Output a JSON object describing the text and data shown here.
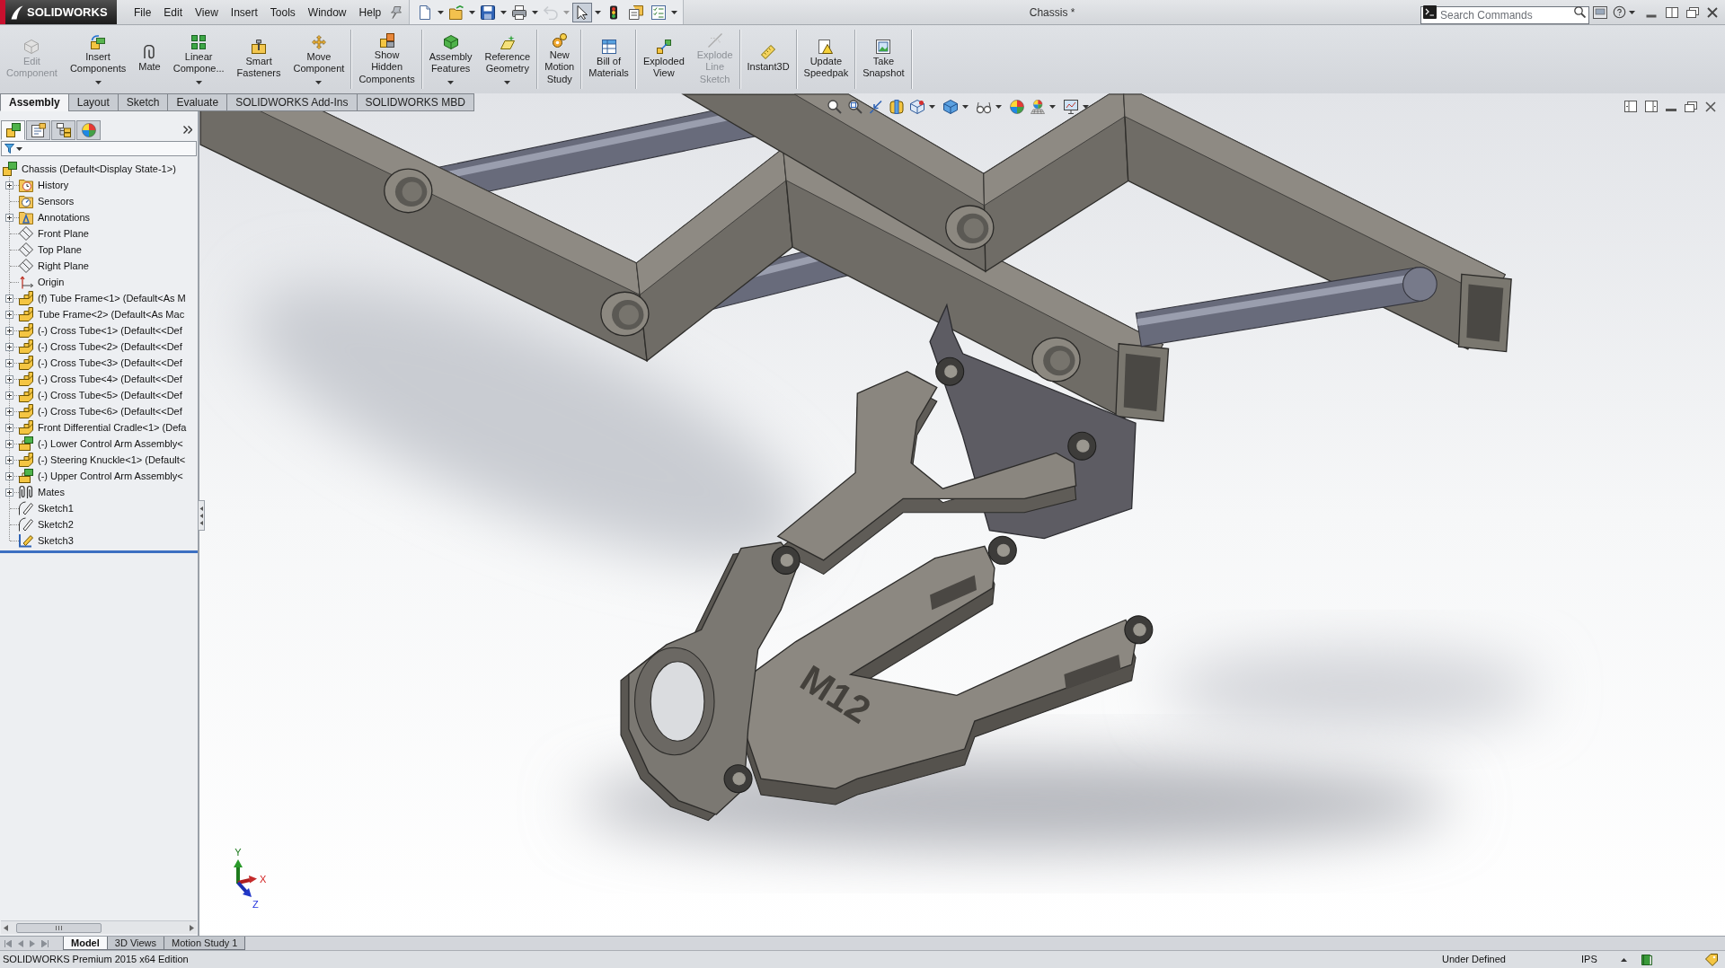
{
  "app": {
    "logo": "SOLIDWORKS",
    "title": "Chassis *"
  },
  "menu_bar": [
    "File",
    "Edit",
    "View",
    "Insert",
    "Tools",
    "Window",
    "Help"
  ],
  "quick_access": [
    {
      "menu": true,
      "disabled": false,
      "selected": false
    },
    {
      "menu": true,
      "disabled": false,
      "selected": false
    },
    {
      "menu": true,
      "disabled": false,
      "selected": false
    },
    {
      "menu": true,
      "disabled": false,
      "selected": false
    },
    {
      "menu": true,
      "disabled": true,
      "selected": false
    },
    {
      "menu": true,
      "disabled": false,
      "selected": true
    },
    {
      "menu": false,
      "disabled": false,
      "selected": false
    },
    {
      "menu": false,
      "disabled": false,
      "selected": false
    },
    {
      "menu": true,
      "disabled": false,
      "selected": false
    }
  ],
  "search": {
    "placeholder": "Search Commands"
  },
  "command_groups": [
    [
      {
        "label": [
          "Edit",
          "Component"
        ],
        "disabled": true,
        "menu": false
      },
      {
        "label": [
          "Insert",
          "Components"
        ],
        "disabled": false,
        "menu": true
      },
      {
        "label": [
          "Mate"
        ],
        "disabled": false,
        "menu": false
      },
      {
        "label": [
          "Linear",
          "Compone..."
        ],
        "disabled": false,
        "menu": true
      },
      {
        "label": [
          "Smart",
          "Fasteners"
        ],
        "disabled": false,
        "menu": false
      },
      {
        "label": [
          "Move",
          "Component"
        ],
        "disabled": false,
        "menu": true
      }
    ],
    [
      {
        "label": [
          "Show",
          "Hidden",
          "Components"
        ],
        "disabled": false,
        "menu": false
      }
    ],
    [
      {
        "label": [
          "Assembly",
          "Features"
        ],
        "disabled": false,
        "menu": true
      },
      {
        "label": [
          "Reference",
          "Geometry"
        ],
        "disabled": false,
        "menu": true
      }
    ],
    [
      {
        "label": [
          "New",
          "Motion",
          "Study"
        ],
        "disabled": false,
        "menu": false
      }
    ],
    [
      {
        "label": [
          "Bill of",
          "Materials"
        ],
        "disabled": false,
        "menu": false
      }
    ],
    [
      {
        "label": [
          "Exploded",
          "View"
        ],
        "disabled": false,
        "menu": false
      },
      {
        "label": [
          "Explode",
          "Line",
          "Sketch"
        ],
        "disabled": true,
        "menu": false
      }
    ],
    [
      {
        "label": [
          "Instant3D"
        ],
        "disabled": false,
        "menu": false
      }
    ],
    [
      {
        "label": [
          "Update",
          "Speedpak"
        ],
        "disabled": false,
        "menu": false
      }
    ],
    [
      {
        "label": [
          "Take",
          "Snapshot"
        ],
        "disabled": false,
        "menu": false
      }
    ]
  ],
  "command_tabs": [
    {
      "label": "Assembly",
      "selected": true
    },
    {
      "label": "Layout",
      "selected": false
    },
    {
      "label": "Sketch",
      "selected": false
    },
    {
      "label": "Evaluate",
      "selected": false
    },
    {
      "label": "SOLIDWORKS Add-Ins",
      "selected": false
    },
    {
      "label": "SOLIDWORKS MBD",
      "selected": false
    }
  ],
  "panel_tabs": [
    {
      "selected": true
    },
    {
      "selected": false
    },
    {
      "selected": false
    },
    {
      "selected": false
    }
  ],
  "feature_tree": {
    "label": "Chassis (Default<Display State-1>)",
    "kind": "assembly",
    "children": [
      {
        "label": "History",
        "kind": "history",
        "expandable": true
      },
      {
        "label": "Sensors",
        "kind": "sensors",
        "expandable": false
      },
      {
        "label": "Annotations",
        "kind": "annotations",
        "expandable": true
      },
      {
        "label": "Front Plane",
        "kind": "plane",
        "expandable": false
      },
      {
        "label": "Top Plane",
        "kind": "plane",
        "expandable": false
      },
      {
        "label": "Right Plane",
        "kind": "plane",
        "expandable": false
      },
      {
        "label": "Origin",
        "kind": "origin",
        "expandable": false
      },
      {
        "label": "(f) Tube Frame<1> (Default<As M",
        "kind": "part",
        "expandable": true
      },
      {
        "label": "Tube Frame<2> (Default<As Mac",
        "kind": "part",
        "expandable": true
      },
      {
        "label": "(-) Cross Tube<1> (Default<<Def",
        "kind": "part",
        "expandable": true
      },
      {
        "label": "(-) Cross Tube<2> (Default<<Def",
        "kind": "part",
        "expandable": true
      },
      {
        "label": "(-) Cross Tube<3> (Default<<Def",
        "kind": "part",
        "expandable": true
      },
      {
        "label": "(-) Cross Tube<4> (Default<<Def",
        "kind": "part",
        "expandable": true
      },
      {
        "label": "(-) Cross Tube<5> (Default<<Def",
        "kind": "part",
        "expandable": true
      },
      {
        "label": "(-) Cross Tube<6> (Default<<Def",
        "kind": "part",
        "expandable": true
      },
      {
        "label": "Front Differential Cradle<1> (Defa",
        "kind": "part",
        "expandable": true
      },
      {
        "label": "(-) Lower Control Arm Assembly<",
        "kind": "subassembly",
        "expandable": true
      },
      {
        "label": "(-) Steering Knuckle<1> (Default<",
        "kind": "part",
        "expandable": true
      },
      {
        "label": "(-) Upper Control Arm Assembly<",
        "kind": "subassembly",
        "expandable": true
      },
      {
        "label": "Mates",
        "kind": "mates",
        "expandable": true
      },
      {
        "label": "Sketch1",
        "kind": "sketch",
        "expandable": false
      },
      {
        "label": "Sketch2",
        "kind": "sketch",
        "expandable": false
      },
      {
        "label": "Sketch3",
        "kind": "sketch3d",
        "expandable": false
      }
    ]
  },
  "view_toolbar": [
    {
      "menu": false
    },
    {
      "menu": false
    },
    {
      "menu": false
    },
    {
      "menu": false
    },
    {
      "menu": true
    },
    {
      "menu": true
    },
    {
      "menu": true
    },
    {
      "menu": false
    },
    {
      "menu": true
    },
    {
      "menu": true
    }
  ],
  "model": {
    "engraving": "M12"
  },
  "triad": {
    "x": "X",
    "y": "Y",
    "z": "Z"
  },
  "bottom_tabs": [
    {
      "label": "Model",
      "selected": true
    },
    {
      "label": "3D Views",
      "selected": false
    },
    {
      "label": "Motion Study 1",
      "selected": false
    }
  ],
  "status_bar": {
    "product": "SOLIDWORKS Premium 2015 x64 Edition",
    "state": "Under Defined",
    "units": "IPS"
  }
}
